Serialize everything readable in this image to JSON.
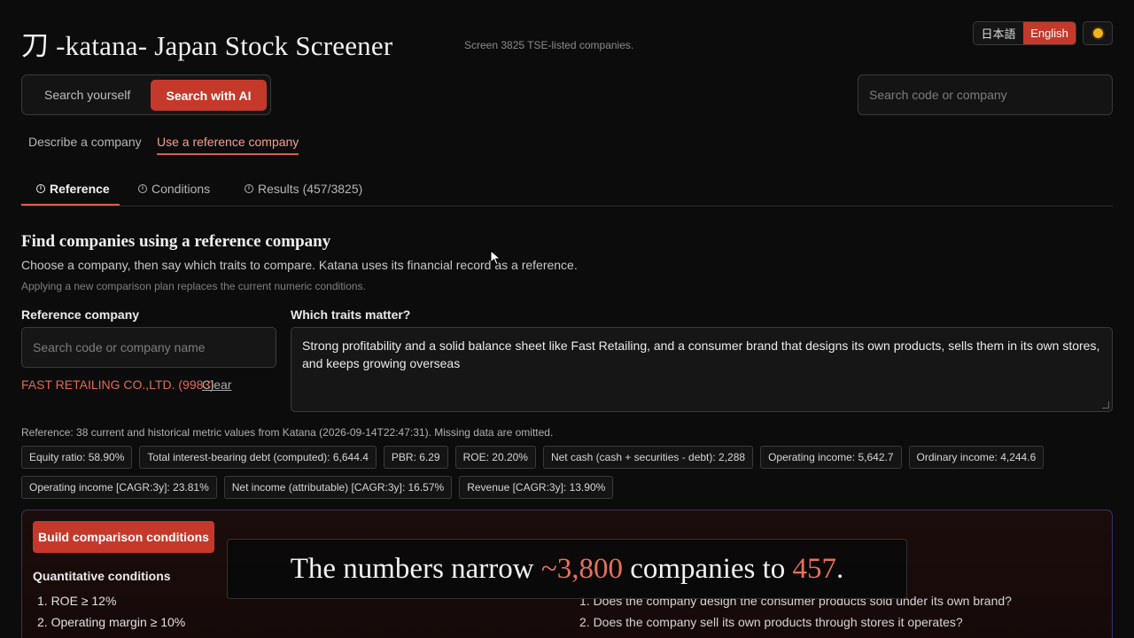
{
  "header": {
    "title": "刀 -katana- Japan Stock Screener",
    "subtitle": "Screen 3825 TSE-listed companies.",
    "lang_ja": "日本語",
    "lang_en": "English",
    "active_lang": "English",
    "theme_icon": "sun-icon"
  },
  "mode": {
    "self_label": "Search yourself",
    "ai_label": "Search with AI",
    "active": "Search with AI"
  },
  "search": {
    "placeholder": "Search code or company"
  },
  "subtabs": {
    "describe": "Describe a company",
    "reference": "Use a reference company",
    "active": "Use a reference company"
  },
  "steps": {
    "reference": "Reference",
    "conditions": "Conditions",
    "results": "Results (457/3825)",
    "active": "Reference"
  },
  "section": {
    "title": "Find companies using a reference company",
    "description": "Choose a company, then say which traits to compare. Katana uses its financial record as a reference.",
    "note": "Applying a new comparison plan replaces the current numeric conditions."
  },
  "reference": {
    "label": "Reference company",
    "placeholder": "Search code or company name",
    "selected": "FAST RETAILING CO.,LTD. (9983)",
    "clear": "Clear"
  },
  "traits": {
    "label": "Which traits matter?",
    "value": "Strong profitability and a solid balance sheet like Fast Retailing, and a consumer brand that designs its own products, sells them in its own stores, and keeps growing overseas"
  },
  "reference_meta": "Reference: 38 current and historical metric values from Katana (2026-09-14T22:47:31). Missing data are omitted.",
  "metrics": [
    "Equity ratio: 58.90%",
    "Total interest-bearing debt (computed): 6,644.4",
    "PBR: 6.29",
    "ROE: 20.20%",
    "Net cash (cash + securities - debt): 2,288",
    "Operating income: 5,642.7",
    "Ordinary income: 4,244.6",
    "Operating income [CAGR:3y]: 23.81%",
    "Net income (attributable) [CAGR:3y]: 16.57%",
    "Revenue [CAGR:3y]: 13.90%"
  ],
  "build": {
    "button": "Build comparison conditions",
    "quant_title": "Quantitative conditions",
    "quant_items": [
      "1. ROE ≥ 12%",
      "2. Operating margin ≥ 10%"
    ],
    "qual_items": [
      "1. Does the company design the consumer products sold under its own brand?",
      "2. Does the company sell its own products through stores it operates?"
    ]
  },
  "caption": {
    "before": "The numbers narrow ",
    "highlight_1": "~3,800",
    "middle": " companies to ",
    "highlight_2": "457",
    "after": "."
  },
  "colors": {
    "accent": "#c5392b",
    "accent_text": "#e36a55",
    "background": "#0c0c0d"
  }
}
